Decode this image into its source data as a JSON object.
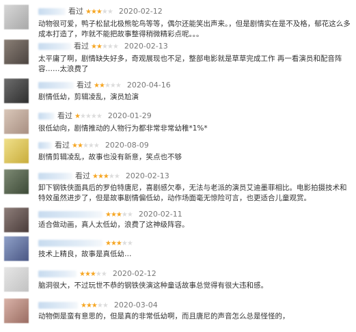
{
  "seen_label": "看过",
  "star_color": "#f6a623",
  "reviews": [
    {
      "rating": 3,
      "date": "2020-02-12",
      "text": "动物很可爱，鸭子松鼠北极熊鸵鸟等等，偶尔还能笑出声来。，但是剧情实在是不及格，郁花这么多成本打造了，咋就不能把故事整得稍微精彩点呢。。。"
    },
    {
      "rating": 2,
      "date": "2020-02-13",
      "text": "太平庸了啊，剧情缺失好多，奇观展现也不足，整部电影就是草草完成工作 再一看演员和配音阵容……太浪费了"
    },
    {
      "rating": 2,
      "date": "2020-04-16",
      "text": "剧情低幼，剪辑凌乱，演员尬演"
    },
    {
      "rating": 1,
      "date": "2020-01-29",
      "text": "很低幼向，剧情推动的人物行为都非常非常幼稚*1%*"
    },
    {
      "rating": 2,
      "date": "2020-08-09",
      "text": "剧情剪辑凌乱，故事也没有新意，笑点也不够"
    },
    {
      "rating": 3,
      "date": "2020-02-13",
      "text": "卸下钢铁侠面具后的罗伯特唐尼，喜剧感欠奉，无法与老派的演员艾迪墨菲相比。电影拍摄技术和特效虽然进步了，但是故事剧情偏低幼，动作场面毫无惊险可言，也更适合儿童观赏。"
    },
    {
      "rating": 3,
      "date": "2020-02-11",
      "text": "适合做动画，真人太低幼，浪费了这神级阵容。"
    },
    {
      "rating": 3,
      "date": "",
      "text": "技术上精良，故事是真低幼…"
    },
    {
      "rating": 3,
      "date": "2020-02-12",
      "text": "脑洞很大，不过玩世不恭的钢铁侠演这种童话故事总觉得有很大违和感。"
    },
    {
      "rating": 3,
      "date": "2020-03-04",
      "text": "动物倒是蛮有意思的，但是真的非常低幼啊，而且唐尼的声音怎么总是怪怪的，"
    }
  ]
}
